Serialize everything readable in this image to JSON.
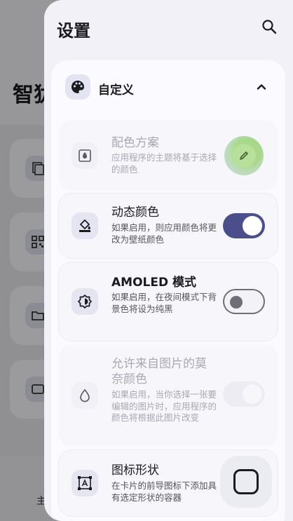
{
  "background": {
    "title": "智犹",
    "nav_label": "主"
  },
  "sheet": {
    "title": "设置",
    "group": {
      "label": "自定义",
      "items": [
        {
          "title": "配色方案",
          "desc": "应用程序的主题将基于选择的颜色",
          "enabled": false
        },
        {
          "title": "动态颜色",
          "desc": "如果启用，则应用颜色将更改为壁纸颜色",
          "toggle": "on"
        },
        {
          "title": "AMOLED 模式",
          "desc": "如果启用，在夜间模式下背景色将设为纯黑",
          "toggle": "off"
        },
        {
          "title": "允许来自图片的莫奈颜色",
          "desc": "如果启用，当你选择一张要编辑的图片时，应用程序的颜色将根据此图片改变",
          "toggle": "on",
          "enabled": false
        },
        {
          "title": "图标形状",
          "desc": "在卡片的前导图标下添加具有选定形状的容器"
        }
      ]
    }
  },
  "colors": {
    "accent": "#4a4f8c",
    "sheet_bg": "#f1f1f7",
    "card_bg": "#fbfbff"
  }
}
